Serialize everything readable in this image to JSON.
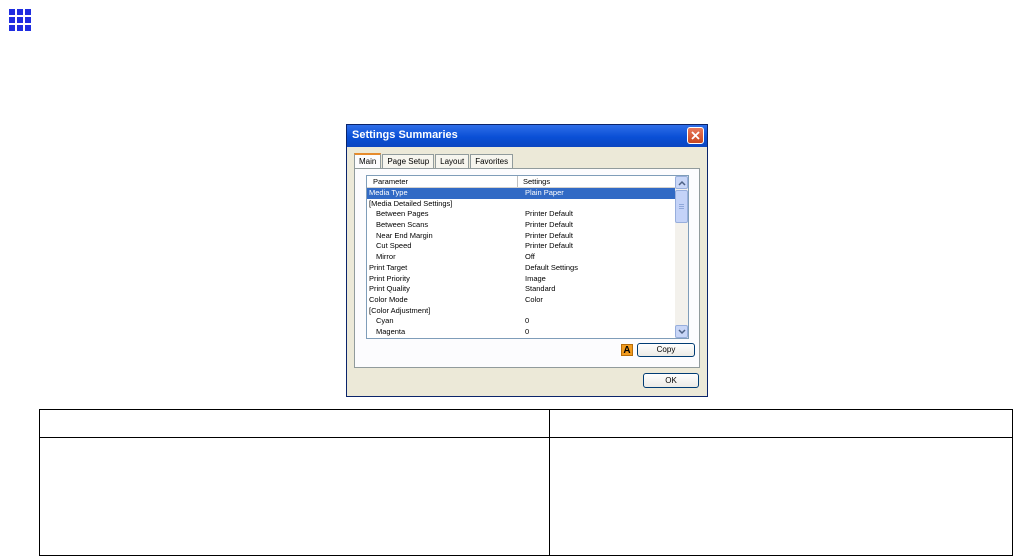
{
  "dialog": {
    "title": "Settings Summaries",
    "tabs": [
      "Main",
      "Page Setup",
      "Layout",
      "Favorites"
    ],
    "active_tab": "Main",
    "list": {
      "columns": [
        "Parameter",
        "Settings"
      ],
      "rows": [
        {
          "parameter": "Media Type",
          "setting": "Plain Paper",
          "selected": true
        },
        {
          "parameter": "[Media Detailed Settings]",
          "setting": ""
        },
        {
          "parameter": "Between Pages",
          "setting": "Printer Default",
          "indent": true
        },
        {
          "parameter": "Between Scans",
          "setting": "Printer Default",
          "indent": true
        },
        {
          "parameter": "Near End Margin",
          "setting": "Printer Default",
          "indent": true
        },
        {
          "parameter": "Cut Speed",
          "setting": "Printer Default",
          "indent": true
        },
        {
          "parameter": "Mirror",
          "setting": "Off",
          "indent": true
        },
        {
          "parameter": "Print Target",
          "setting": "Default Settings"
        },
        {
          "parameter": "Print Priority",
          "setting": "Image"
        },
        {
          "parameter": "Print Quality",
          "setting": "Standard"
        },
        {
          "parameter": "Color Mode",
          "setting": "Color"
        },
        {
          "parameter": "[Color Adjustment]",
          "setting": ""
        },
        {
          "parameter": "Cyan",
          "setting": "0",
          "indent": true
        },
        {
          "parameter": "Magenta",
          "setting": "0",
          "indent": true
        }
      ]
    },
    "badge_label": "A",
    "copy_label": "Copy",
    "ok_label": "OK"
  },
  "colors": {
    "titlebar": "#0a4fd6",
    "selection": "#316ac5",
    "badge": "#f29c1f",
    "grid_icon": "#1f2de0"
  }
}
